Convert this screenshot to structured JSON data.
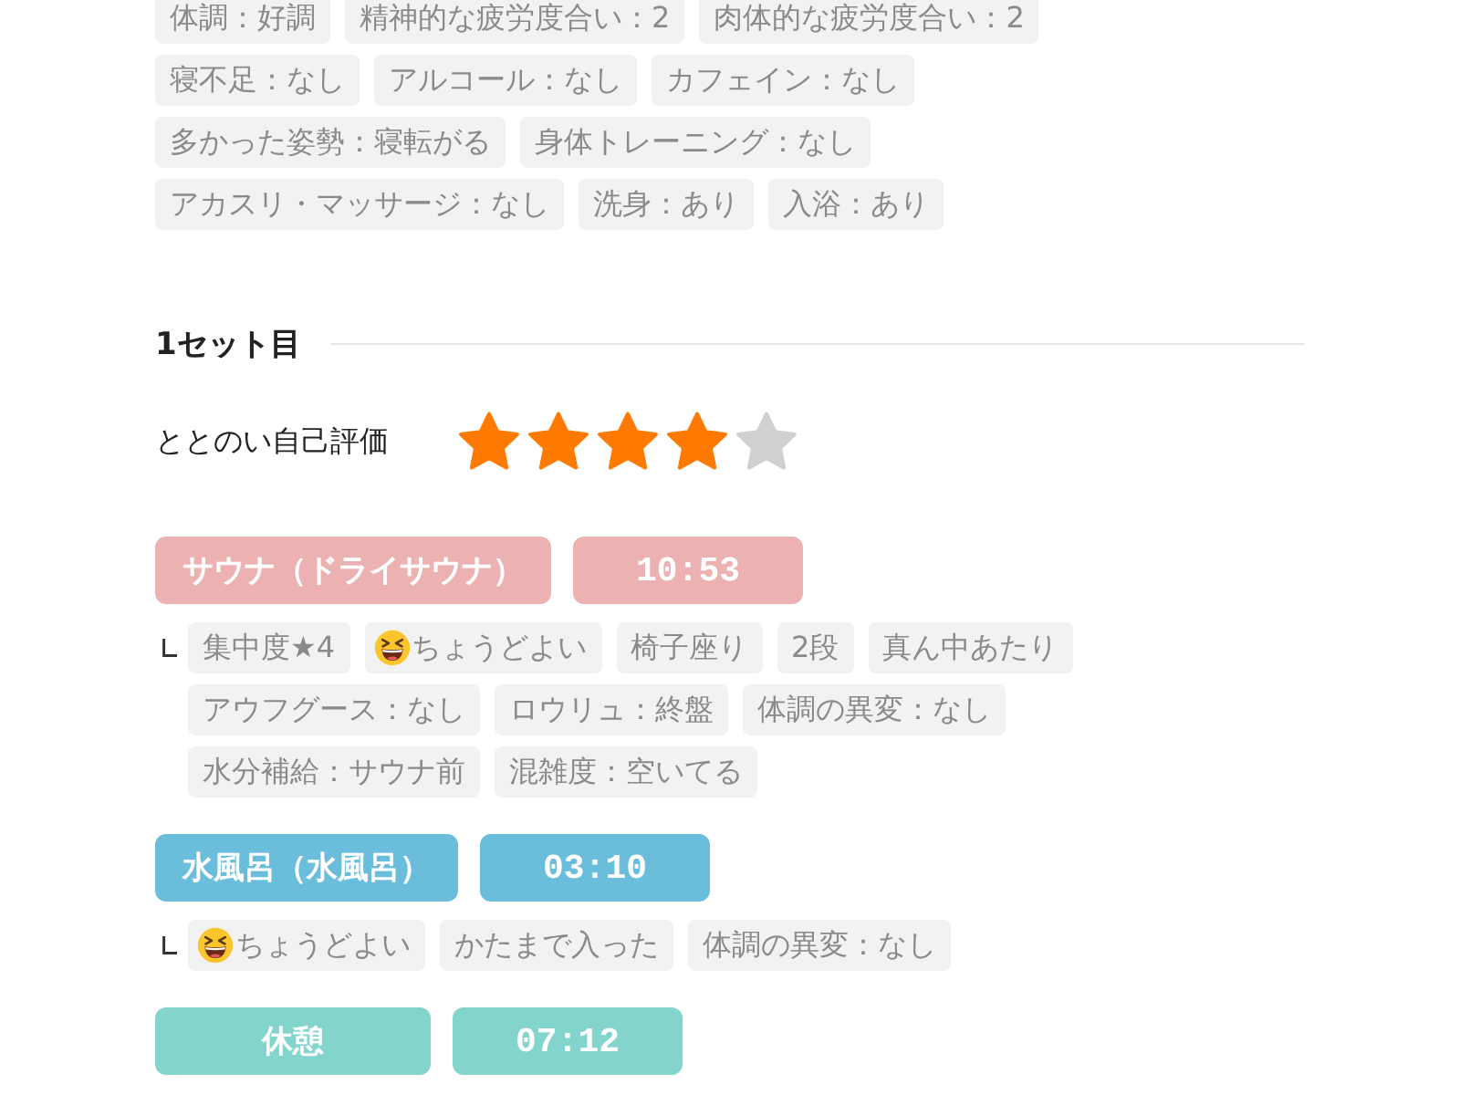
{
  "conditions": [
    "体調：好調",
    "精神的な疲労度合い：2",
    "肉体的な疲労度合い：2",
    "寝不足：なし",
    "アルコール：なし",
    "カフェイン：なし",
    "多かった姿勢：寝転がる",
    "身体トレーニング：なし",
    "アカスリ・マッサージ：なし",
    "洗身：あり",
    "入浴：あり"
  ],
  "sets": [
    {
      "title": "1セット目",
      "rating": {
        "label": "ととのい自己評価",
        "stars": 4
      },
      "steps": [
        {
          "name": "サウナ（ドライサウナ）",
          "time": "10:53",
          "color": "#ecb1b1",
          "tags": [
            {
              "kind": "plain",
              "text": "集中度★4"
            },
            {
              "kind": "mood",
              "text": "ちょうどよい"
            },
            {
              "kind": "plain",
              "text": "椅子座り"
            },
            {
              "kind": "plain",
              "text": "2段"
            },
            {
              "kind": "plain",
              "text": "真ん中あたり"
            },
            {
              "kind": "plain",
              "text": "アウフグース：なし"
            },
            {
              "kind": "plain",
              "text": "ロウリュ：終盤"
            },
            {
              "kind": "plain",
              "text": "体調の異変：なし"
            },
            {
              "kind": "plain",
              "text": "水分補給：サウナ前"
            },
            {
              "kind": "plain",
              "text": "混雑度：空いてる"
            }
          ]
        },
        {
          "name": "水風呂（水風呂）",
          "time": "03:10",
          "color": "#6bbedb",
          "tags": [
            {
              "kind": "mood",
              "text": "ちょうどよい"
            },
            {
              "kind": "plain",
              "text": "かたまで入った"
            },
            {
              "kind": "plain",
              "text": "体調の異変：なし"
            }
          ]
        },
        {
          "name": "休憩",
          "time": "07:12",
          "color": "#82d4cc"
        }
      ]
    }
  ]
}
